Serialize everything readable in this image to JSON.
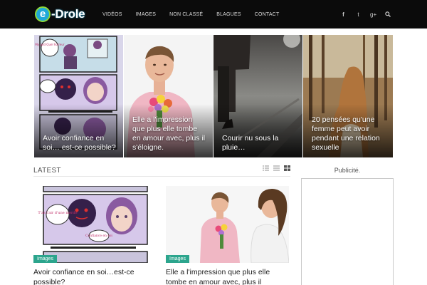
{
  "header": {
    "logo": {
      "badge": "e",
      "text": "-Drole"
    },
    "nav": [
      "VIDÉOS",
      "IMAGES",
      "NON CLASSÉ",
      "BLAGUES",
      "CONTACT"
    ],
    "social": [
      "f",
      "t",
      "g+"
    ]
  },
  "featured": [
    {
      "title": "Avoir confiance en soi… est-ce possible?"
    },
    {
      "title": "Elle a l'impression que plus elle tombe en amour avec, plus il s'éloigne."
    },
    {
      "title": "Courir nu sous la pluie…"
    },
    {
      "title": "20 pensées qu'une femme peut avoir pendant une relation sexuelle"
    }
  ],
  "latest": {
    "title": "LATEST",
    "posts": [
      {
        "category": "Images",
        "title": "Avoir confiance en soi…est-ce possible?"
      },
      {
        "category": "Images",
        "title": "Elle a l'impression que plus elle tombe en amour avec, plus il"
      }
    ]
  },
  "sidebar": {
    "title": "Publicité."
  },
  "comic": {
    "bubble1": "My god Quel horreur",
    "bubble2": "T'as l'air d'une merde",
    "bubble3": "Confiance en soi"
  },
  "colors": {
    "header_bg": "#0b0b0b",
    "category_badge": "#2ca58d",
    "logo_accent": "#8ed83a"
  }
}
